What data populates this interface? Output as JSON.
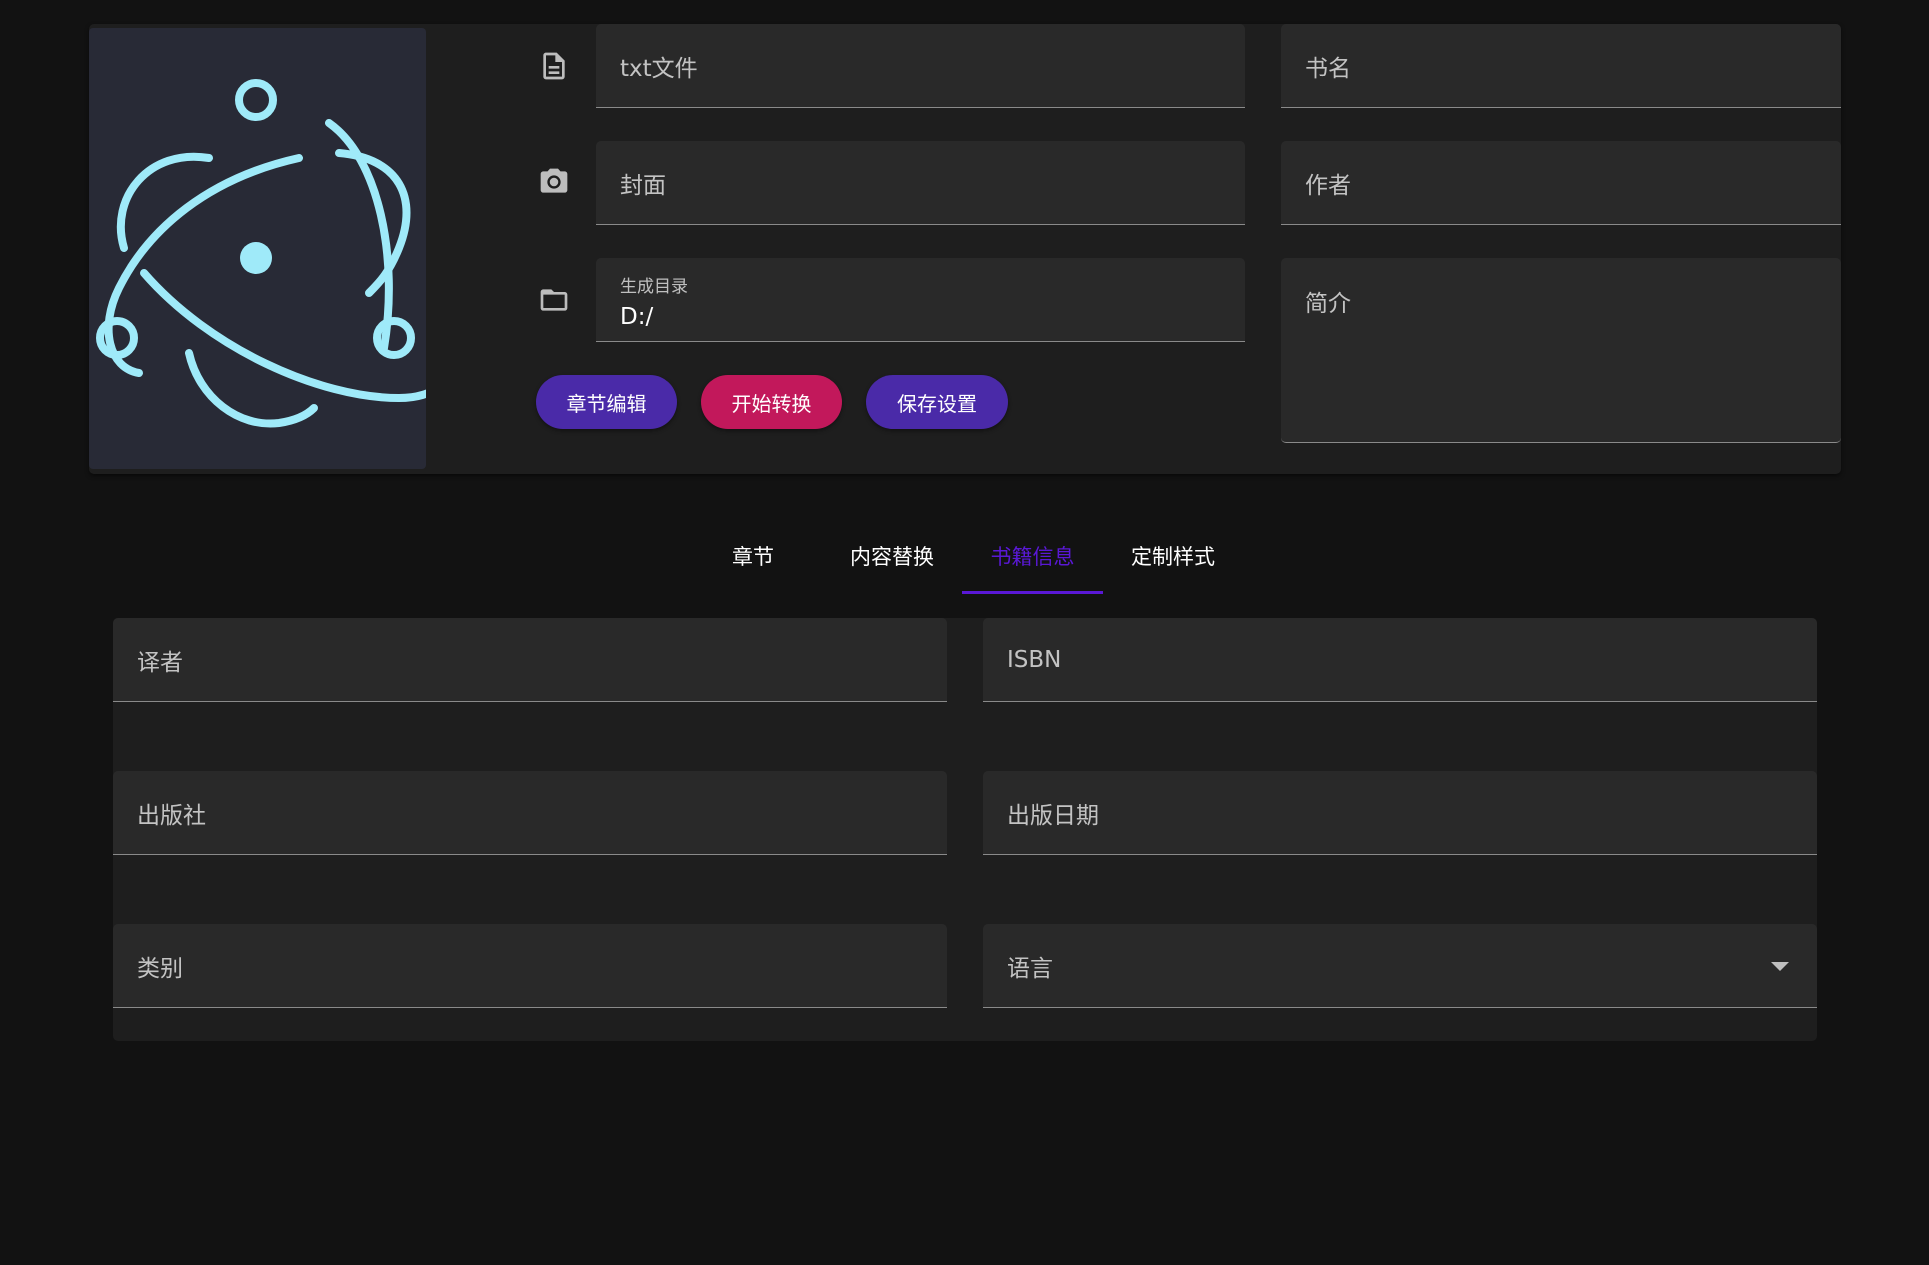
{
  "top": {
    "fields": {
      "txt_file": "txt文件",
      "cover": "封面",
      "output_dir_label": "生成目录",
      "output_dir_value": "D:/",
      "book_title": "书名",
      "author": "作者",
      "description": "简介"
    },
    "icons": {
      "txt_file": "file-document-icon",
      "cover": "camera-icon",
      "output_dir": "folder-icon"
    },
    "buttons": {
      "chapter_edit": "章节编辑",
      "start_convert": "开始转换",
      "save_settings": "保存设置"
    },
    "colors": {
      "chapter_edit": "#4a2aa8",
      "start_convert": "#c2185b",
      "save_settings": "#4a2aa8",
      "logo": "#9feaf9"
    }
  },
  "tabs": [
    {
      "label": "章节",
      "active": false
    },
    {
      "label": "内容替换",
      "active": false
    },
    {
      "label": "书籍信息",
      "active": true
    },
    {
      "label": "定制样式",
      "active": false
    }
  ],
  "info": {
    "translator": "译者",
    "isbn": "ISBN",
    "publisher": "出版社",
    "publish_date": "出版日期",
    "category": "类别",
    "language": "语言"
  },
  "accent": "#5a18d6"
}
